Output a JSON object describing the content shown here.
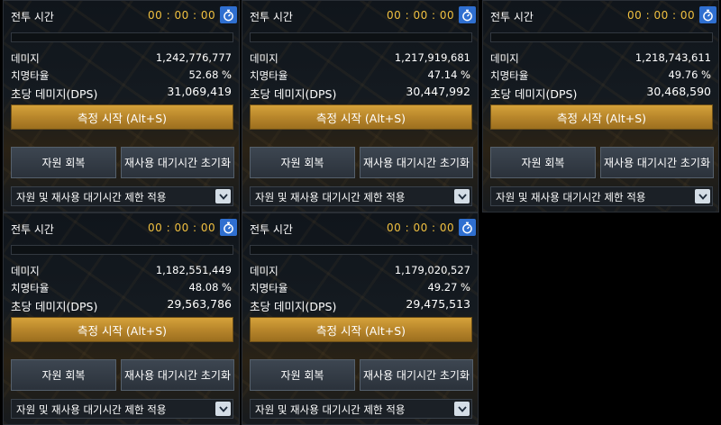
{
  "panels": [
    {
      "title": "전투 시간",
      "timer": "00 : 00 : 00",
      "damage_label": "데미지",
      "damage_value": "1,242,776,777",
      "crit_label": "치명타율",
      "crit_value": "52.68 %",
      "dps_label": "초당 데미지(DPS)",
      "dps_value": "31,069,419",
      "start_label": "측정 시작 (Alt+S)",
      "recover_label": "자원 회복",
      "reset_label": "재사용 대기시간 초기화",
      "limit_label": "자원 및 재사용 대기시간 제한 적용"
    },
    {
      "title": "전투 시간",
      "timer": "00 : 00 : 00",
      "damage_label": "데미지",
      "damage_value": "1,217,919,681",
      "crit_label": "치명타율",
      "crit_value": "47.14 %",
      "dps_label": "초당 데미지(DPS)",
      "dps_value": "30,447,992",
      "start_label": "측정 시작 (Alt+S)",
      "recover_label": "자원 회복",
      "reset_label": "재사용 대기시간 초기화",
      "limit_label": "자원 및 재사용 대기시간 제한 적용"
    },
    {
      "title": "전투 시간",
      "timer": "00 : 00 : 00",
      "damage_label": "데미지",
      "damage_value": "1,218,743,611",
      "crit_label": "치명타율",
      "crit_value": "49.76 %",
      "dps_label": "초당 데미지(DPS)",
      "dps_value": "30,468,590",
      "start_label": "측정 시작 (Alt+S)",
      "recover_label": "자원 회복",
      "reset_label": "재사용 대기시간 초기화",
      "limit_label": "자원 및 재사용 대기시간 제한 적용"
    },
    {
      "title": "전투 시간",
      "timer": "00 : 00 : 00",
      "damage_label": "데미지",
      "damage_value": "1,182,551,449",
      "crit_label": "치명타율",
      "crit_value": "48.08 %",
      "dps_label": "초당 데미지(DPS)",
      "dps_value": "29,563,786",
      "start_label": "측정 시작 (Alt+S)",
      "recover_label": "자원 회복",
      "reset_label": "재사용 대기시간 초기화",
      "limit_label": "자원 및 재사용 대기시간 제한 적용"
    },
    {
      "title": "전투 시간",
      "timer": "00 : 00 : 00",
      "damage_label": "데미지",
      "damage_value": "1,179,020,527",
      "crit_label": "치명타율",
      "crit_value": "49.27 %",
      "dps_label": "초당 데미지(DPS)",
      "dps_value": "29,475,513",
      "start_label": "측정 시작 (Alt+S)",
      "recover_label": "자원 회복",
      "reset_label": "재사용 대기시간 초기화",
      "limit_label": "자원 및 재사용 대기시간 제한 적용"
    }
  ],
  "colors": {
    "timer": "#f0c040",
    "accent_gold": "#c8952f",
    "timer_button": "#2f6fd0"
  },
  "icons": {
    "timer_button": "stopwatch-icon",
    "dropdown": "chevron-down-icon"
  }
}
